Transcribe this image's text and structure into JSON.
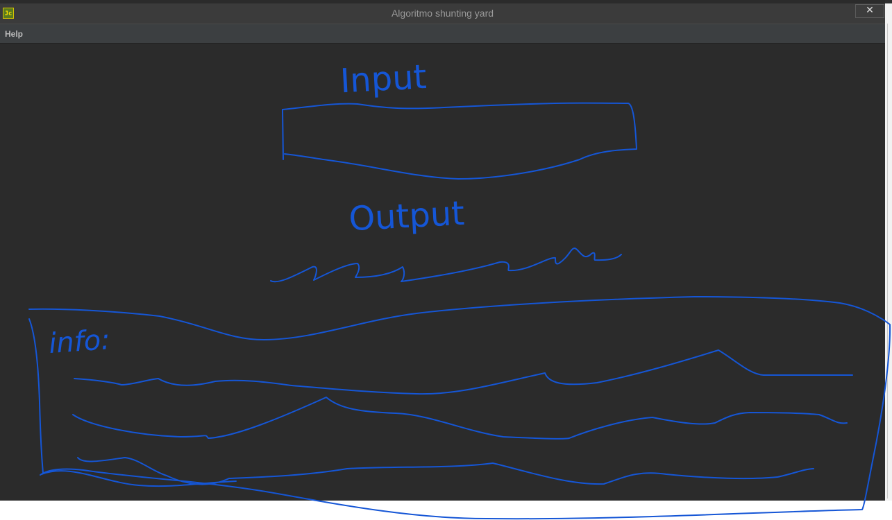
{
  "window": {
    "title": "Algoritmo shunting yard",
    "app_icon_text": "Jc",
    "close_glyph": "✕"
  },
  "menu": {
    "items": [
      {
        "label": "Help"
      }
    ]
  },
  "sketch": {
    "input_label": "Input",
    "output_label": "Output",
    "info_label": "info:",
    "ink_color": "#1556d6"
  },
  "colors": {
    "window_bg": "#2b2b2b",
    "menu_bg": "#3c3f41",
    "title_bg": "#3b3b3b"
  }
}
